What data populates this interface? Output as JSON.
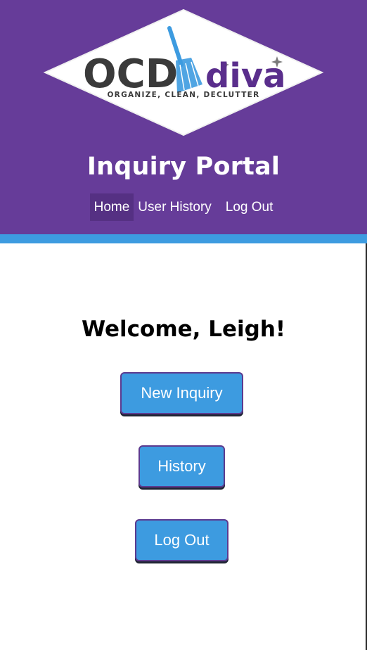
{
  "header": {
    "logo": {
      "main_text": "OCD",
      "accent_text": "diva",
      "tagline": "ORGANIZE, CLEAN, DECLUTTER"
    },
    "title": "Inquiry Portal",
    "nav": [
      {
        "label": "Home",
        "active": true
      },
      {
        "label": "User History",
        "active": false
      },
      {
        "label": "Log Out",
        "active": false
      }
    ]
  },
  "main": {
    "welcome": "Welcome, Leigh!",
    "buttons": [
      {
        "label": "New Inquiry"
      },
      {
        "label": "History"
      },
      {
        "label": "Log Out"
      }
    ]
  },
  "colors": {
    "header_bg": "#663c99",
    "accent_bar": "#3d9be0",
    "button_bg": "#3d9be0",
    "nav_active_bg": "#553083"
  }
}
